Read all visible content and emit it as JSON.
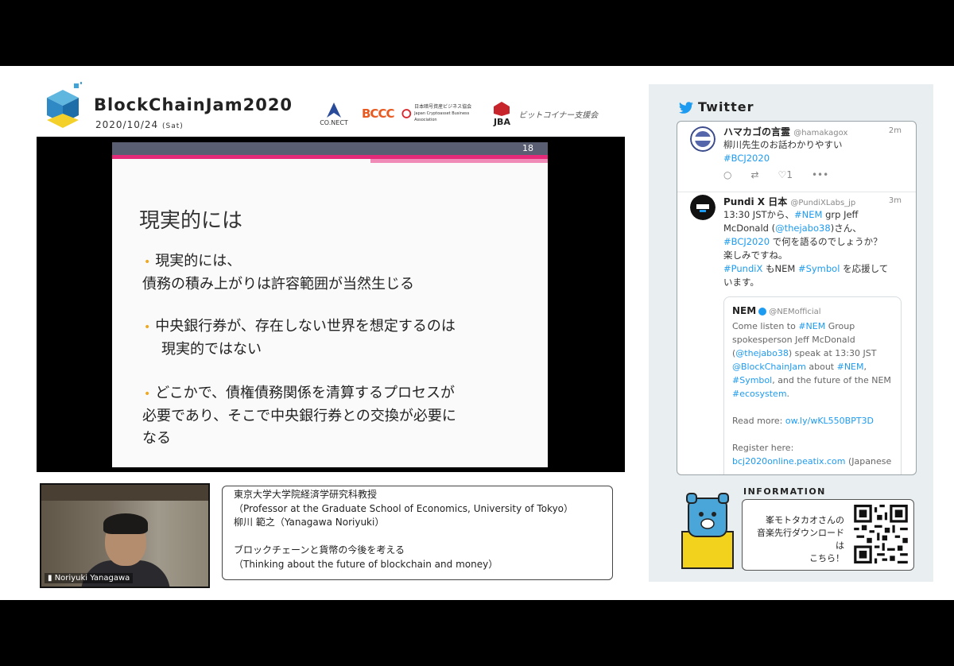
{
  "header": {
    "title": "BlockChainJam2020",
    "date": "2020/10/24",
    "day": "(Sat)",
    "sponsors": {
      "connect": "CO.NECT",
      "bccc": "BCCC",
      "jcba_jp": "日本暗号資産ビジネス協会",
      "jcba_en": "Japan Cryptoasset Business Association",
      "jba": "JBA",
      "bd": "ビットコイナー支援会"
    }
  },
  "slide": {
    "number": "18",
    "title": "現実的には",
    "bullets": [
      [
        "現実的には、",
        "債務の積み上がりは許容範囲が当然生じる"
      ],
      [
        "中央銀行券が、存在しない世界を想定するのは",
        "現実的ではない"
      ],
      [
        "どこかで、債権債務関係を清算するプロセスが",
        "必要であり、そこで中央銀行券との交換が必要に",
        "なる"
      ]
    ]
  },
  "speaker": {
    "video_name": "Noriyuki Yanagawa",
    "info_lines": [
      "東京大学大学院経済学研究科教授",
      "（Professor at the Graduate School of Economics, University of Tokyo）",
      "柳川 範之（Yanagawa Noriyuki）",
      "",
      "ブロックチェーンと貨幣の今後を考える",
      "（Thinking about the future of blockchain and money）"
    ]
  },
  "twitter": {
    "title": "Twitter",
    "tweets": [
      {
        "name": "ハマカゴの言霊",
        "handle": "@hamakagox",
        "time": "2m",
        "text": "柳川先生のお話わかりやすい",
        "tag": "#BCJ2020",
        "likes": "1"
      },
      {
        "name": "Pundi X 日本",
        "handle": "@PundiXLabs_jp",
        "time": "3m",
        "lines": [
          "13:30 JSTから、#NEM grp Jeff",
          "McDonald (@thejabo38)さん、",
          "#BCJ2020 で何を語るのでしょうか？",
          "楽しみですね。",
          "#PundiX もNEM #Symbol を応援して",
          "います。"
        ],
        "quote": {
          "name": "NEM",
          "handle": "@NEMofficial",
          "lines": [
            "Come listen to #NEM Group",
            "spokesperson Jeff McDonald",
            "(@thejabo38) speak at 13:30 JST",
            "@BlockChainJam about #NEM,",
            "#Symbol, and the future of the NEM",
            "#ecosystem.",
            "",
            "Read more: ow.ly/wKL550BPT3D",
            "",
            "Register here:",
            "bcj2020online.peatix.com (Japanese"
          ]
        }
      }
    ]
  },
  "information": {
    "label": "INFORMATION",
    "text_lines": [
      "峯モトタカオさんの",
      "音楽先行ダウンロードは",
      "こちら！"
    ]
  },
  "colors": {
    "slide_pink": "#e62a7a",
    "slide_bar": "#5a5e72",
    "bullet_dot": "#f0a81e",
    "twitter_blue": "#1d9bf0",
    "panel_bg": "#e9eef0"
  }
}
